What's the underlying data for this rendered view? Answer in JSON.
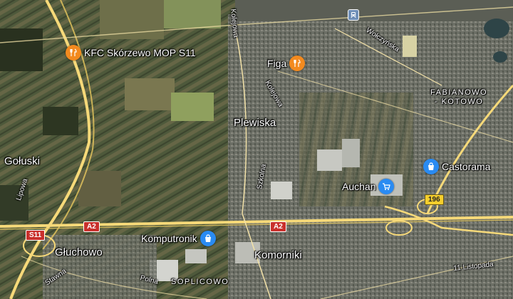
{
  "colors": {
    "food_pin": "#f38a1f",
    "shop_pin": "#2a8bf2",
    "road_main": "#f6d979",
    "route_red": "#c9302c",
    "route_yellow": "#f5cf2d"
  },
  "places": {
    "plewiska": "Plewiska",
    "goluski": "Gołuski",
    "gluchowo": "Głuchowo",
    "komorniki": "Komorniki",
    "soplicowo": "SOPLICOWO",
    "fabianowo_line1": "FABIANOWO",
    "fabianowo_line2": "- KOTOWO"
  },
  "streets": {
    "kolejowa_north": "Kolejowa",
    "kolejowa_mid": "Kolejowa",
    "wolczynska": "Wołczyńska",
    "szkolna": "Szkolna",
    "lipowa": "Lipowa",
    "stawna": "Stawna",
    "polna": "Polna",
    "listopada": "11 Listopada"
  },
  "pois": [
    {
      "name": "KFC Skórzewo MOP S11",
      "icon": "restaurant-icon"
    },
    {
      "name": "Figa",
      "icon": "restaurant-icon"
    },
    {
      "name": "Castorama",
      "icon": "shopping-bag-icon"
    },
    {
      "name": "Auchan",
      "icon": "shopping-cart-icon"
    },
    {
      "name": "Komputronik",
      "icon": "shopping-bag-icon"
    }
  ],
  "route_shields": {
    "s11": "S11",
    "a2_west": "A2",
    "a2_east": "A2",
    "r196": "196"
  },
  "transit": {
    "rail_station_icon": "train-icon"
  }
}
